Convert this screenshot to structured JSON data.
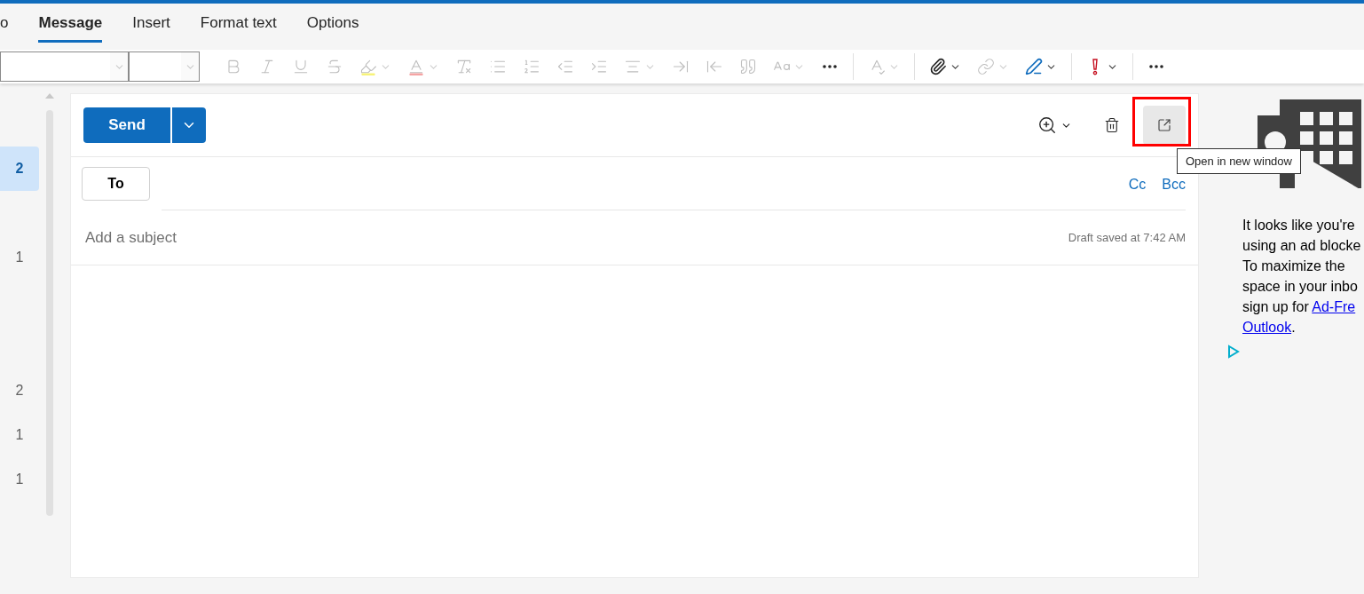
{
  "tabs": [
    {
      "label": "o",
      "selected": false
    },
    {
      "label": "Message",
      "selected": true
    },
    {
      "label": "Insert",
      "selected": false
    },
    {
      "label": "Format text",
      "selected": false
    },
    {
      "label": "Options",
      "selected": false
    }
  ],
  "toolbar": {
    "font_field": {
      "disabled": true
    },
    "size_field": {
      "disabled": true
    },
    "tools": [
      {
        "disabled": true,
        "menu": false
      },
      {
        "disabled": true,
        "menu": false
      },
      {
        "disabled": true,
        "menu": false
      },
      {
        "disabled": true,
        "menu": false
      },
      {
        "disabled": true,
        "menu": true
      },
      {
        "disabled": true,
        "menu": true
      },
      {
        "disabled": true,
        "menu": false
      },
      {
        "disabled": true,
        "menu": false
      },
      {
        "disabled": true,
        "menu": false
      },
      {
        "disabled": true,
        "menu": false
      },
      {
        "disabled": true,
        "menu": false
      },
      {
        "disabled": true,
        "menu": true
      },
      {
        "disabled": true,
        "menu": false
      },
      {
        "disabled": true,
        "menu": false
      },
      {
        "disabled": true,
        "menu": false
      },
      {
        "disabled": true,
        "menu": true
      },
      {
        "disabled": false,
        "menu": false
      },
      {
        "disabled": true,
        "menu": true
      },
      {
        "disabled": false,
        "menu": true
      },
      {
        "disabled": true,
        "menu": true
      },
      {
        "disabled": false,
        "menu": true
      },
      {
        "disabled": false,
        "menu": true
      },
      {
        "disabled": false,
        "menu": false
      }
    ]
  },
  "folder_counts": [
    {
      "count": "2",
      "selected": true
    },
    {
      "count": "1",
      "selected": false
    },
    {
      "count": "2",
      "selected": false
    },
    {
      "count": "1",
      "selected": false
    },
    {
      "count": "1",
      "selected": false
    }
  ],
  "compose": {
    "send": "Send",
    "to": "To",
    "cc": "Cc",
    "bcc": "Bcc",
    "subject_placeholder": "Add a subject",
    "draft_status": "Draft saved at 7:42 AM"
  },
  "tooltip": "Open in new window",
  "ad": {
    "lines": [
      "It looks like you're",
      "using an ad blocke",
      "To maximize the",
      "space in your inbo"
    ],
    "link_prefix": "sign up for ",
    "link_lines": [
      "Ad-Fre",
      "Outlook"
    ],
    "suffix": "."
  }
}
